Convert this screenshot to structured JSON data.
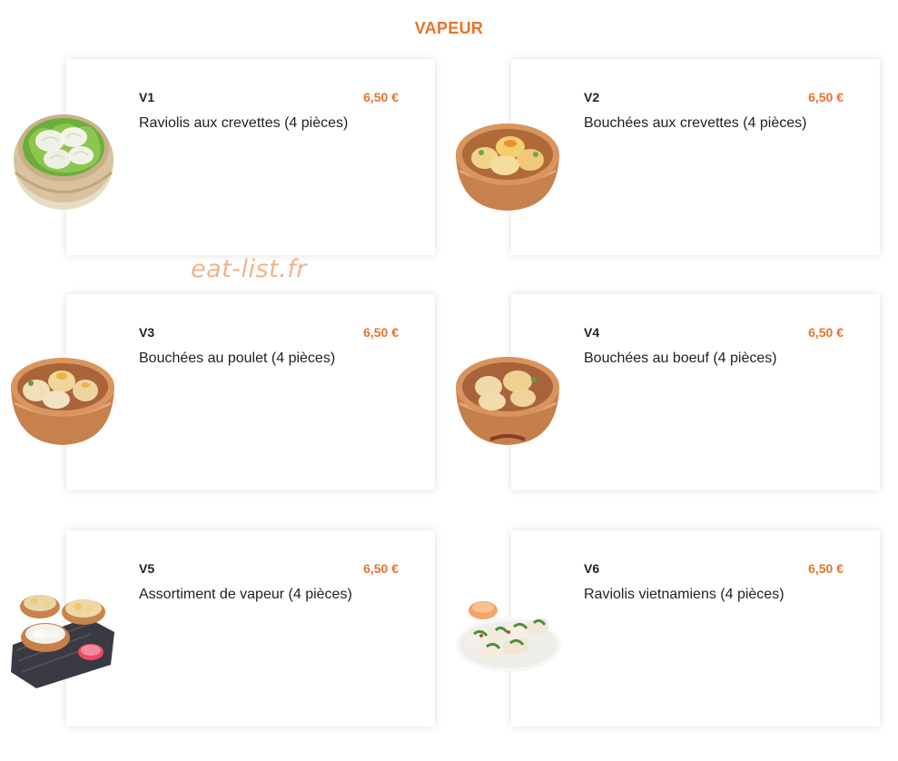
{
  "section": {
    "title": "VAPEUR"
  },
  "watermark": "eat-list.fr",
  "colors": {
    "accent": "#e8732a",
    "text": "#222222",
    "card_bg": "#ffffff"
  },
  "items": [
    {
      "code": "V1",
      "price": "6,50 €",
      "name": "Raviolis aux crevettes (4 pièces)",
      "image": "har-gow-steamer-image"
    },
    {
      "code": "V2",
      "price": "6,50 €",
      "name": "Bouchées aux crevettes (4 pièces)",
      "image": "siu-mai-steamer-image"
    },
    {
      "code": "V3",
      "price": "6,50 €",
      "name": "Bouchées au poulet (4 pièces)",
      "image": "chicken-dumplings-steamer-image"
    },
    {
      "code": "V4",
      "price": "6,50 €",
      "name": "Bouchées au boeuf (4 pièces)",
      "image": "beef-dumplings-steamer-image"
    },
    {
      "code": "V5",
      "price": "6,50 €",
      "name": "Assortiment de vapeur (4 pièces)",
      "image": "assorted-steamers-image"
    },
    {
      "code": "V6",
      "price": "6,50 €",
      "name": "Raviolis vietnamiens (4 pièces)",
      "image": "vietnamese-rolls-plate-image"
    }
  ]
}
